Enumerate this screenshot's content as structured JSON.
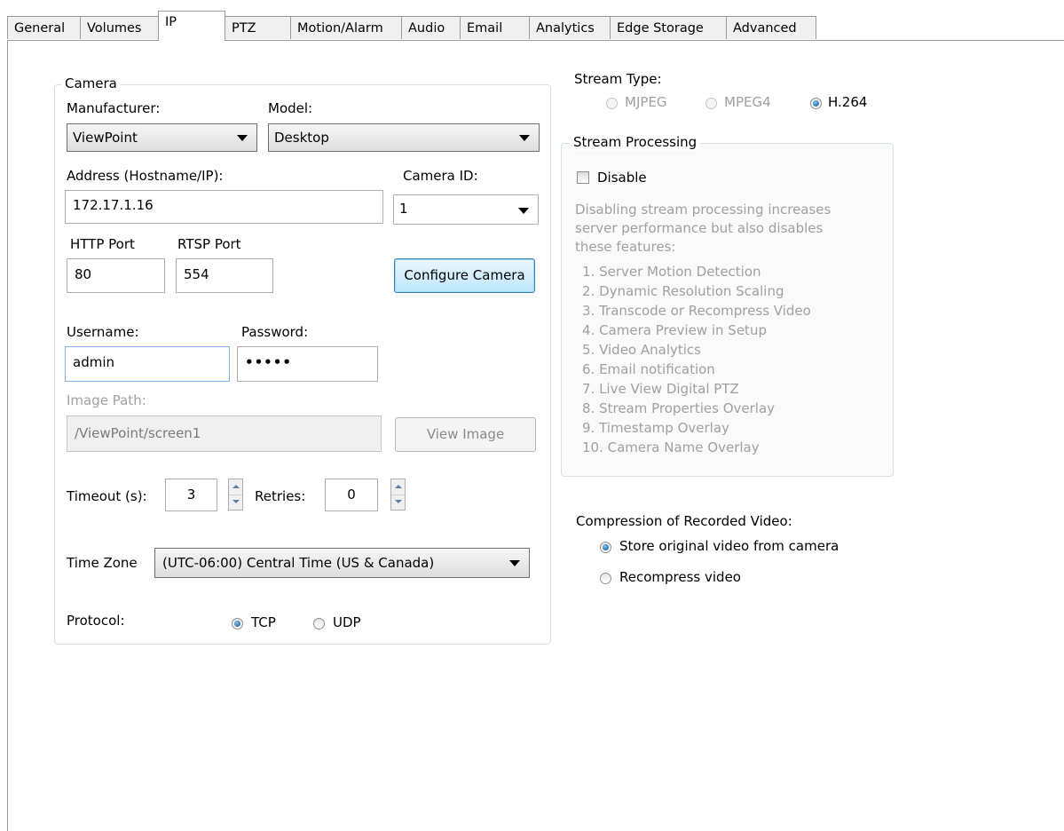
{
  "tabs": [
    {
      "label": "General"
    },
    {
      "label": "Volumes"
    },
    {
      "label": "IP"
    },
    {
      "label": "PTZ"
    },
    {
      "label": "Motion/Alarm"
    },
    {
      "label": "Audio"
    },
    {
      "label": "Email"
    },
    {
      "label": "Analytics"
    },
    {
      "label": "Edge Storage"
    },
    {
      "label": "Advanced"
    }
  ],
  "active_tab": "IP",
  "camera": {
    "group_title": "Camera",
    "manufacturer_label": "Manufacturer:",
    "manufacturer_value": "ViewPoint",
    "model_label": "Model:",
    "model_value": "Desktop",
    "address_label": "Address (Hostname/IP):",
    "address_value": "172.17.1.16",
    "camera_id_label": "Camera ID:",
    "camera_id_value": "1",
    "http_port_label": "HTTP Port",
    "http_port_value": "80",
    "rtsp_port_label": "RTSP Port",
    "rtsp_port_value": "554",
    "configure_button": "Configure Camera",
    "username_label": "Username:",
    "username_value": "admin",
    "password_label": "Password:",
    "password_value": "•••••",
    "image_path_label": "Image Path:",
    "image_path_value": "/ViewPoint/screen1",
    "view_image_button": "View Image",
    "timeout_label": "Timeout (s):",
    "timeout_value": "3",
    "retries_label": "Retries:",
    "retries_value": "0",
    "timezone_label": "Time Zone",
    "timezone_value": "(UTC-06:00) Central Time (US & Canada)",
    "protocol_label": "Protocol:",
    "protocol_options": [
      "TCP",
      "UDP"
    ],
    "protocol_selected": "TCP"
  },
  "stream_type": {
    "label": "Stream Type:",
    "options": [
      "MJPEG",
      "MPEG4",
      "H.264"
    ],
    "selected": "H.264"
  },
  "stream_processing": {
    "group_title": "Stream Processing",
    "disable_label": "Disable",
    "disable_checked": false,
    "description": [
      "Disabling stream processing increases",
      "server performance but also disables",
      "these features:"
    ],
    "features": [
      "1. Server Motion Detection",
      "2. Dynamic Resolution Scaling",
      "3. Transcode or Recompress Video",
      "4. Camera Preview in Setup",
      "5. Video Analytics",
      "6. Email notification",
      "7. Live View Digital PTZ",
      "8. Stream Properties Overlay",
      "9. Timestamp Overlay",
      "10. Camera Name Overlay"
    ]
  },
  "compression": {
    "label": "Compression of Recorded Video:",
    "options": [
      "Store original video from camera",
      "Recompress video"
    ],
    "selected": "Store original video from camera"
  }
}
